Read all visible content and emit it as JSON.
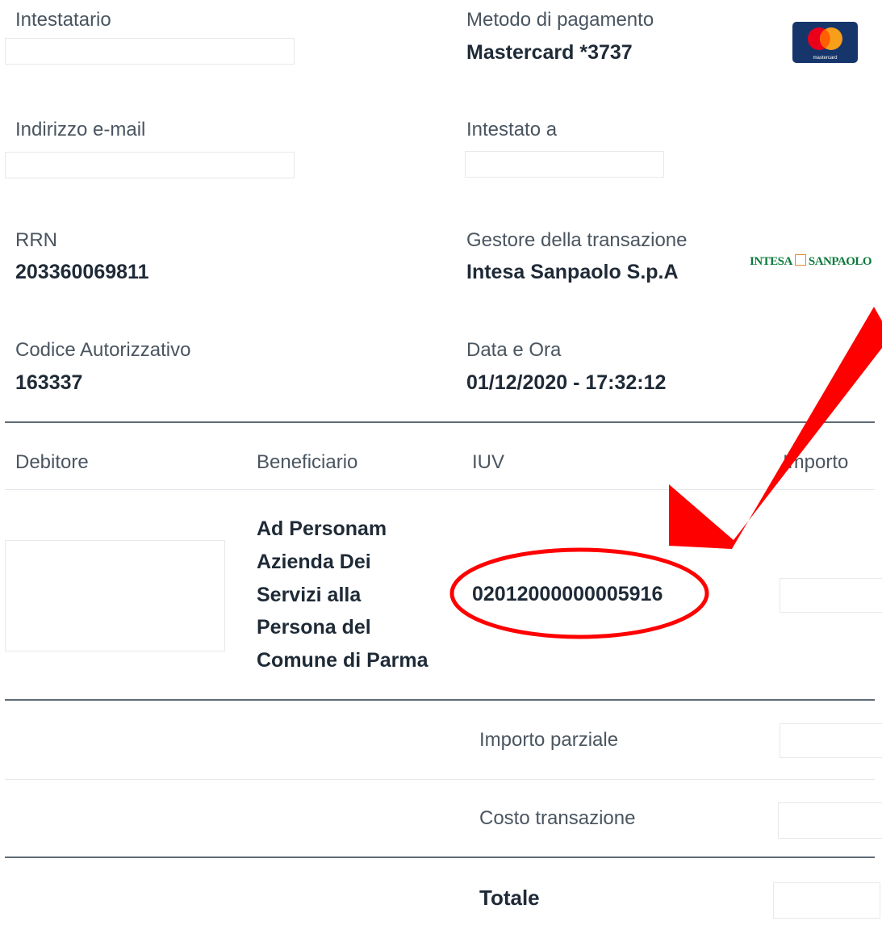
{
  "details": {
    "intestatario_label": "Intestatario",
    "metodo_label": "Metodo di pagamento",
    "metodo_value": "Mastercard *3737",
    "email_label": "Indirizzo e-mail",
    "intestato_label": "Intestato a",
    "rrn_label": "RRN",
    "rrn_value": "203360069811",
    "gestore_label": "Gestore della transazione",
    "gestore_value": "Intesa Sanpaolo S.p.A",
    "codice_label": "Codice Autorizzativo",
    "codice_value": "163337",
    "data_label": "Data e Ora",
    "data_value": "01/12/2020 - 17:32:12"
  },
  "logos": {
    "mastercard_small_text": "mastercard",
    "intesa_left": "INTESA",
    "intesa_right": "SANPAOLO"
  },
  "table": {
    "headers": [
      "Debitore",
      "Beneficiario",
      "IUV",
      "Importo"
    ],
    "row": {
      "beneficiario_lines": [
        "Ad Personam",
        "Azienda Dei",
        "Servizi alla",
        "Persona del",
        "Comune di Parma"
      ],
      "iuv": "02012000000005916"
    }
  },
  "summary": {
    "parziale_label": "Importo parziale",
    "costo_label": "Costo transazione",
    "totale_label": "Totale"
  },
  "colors": {
    "annotation_red": "#ff0000",
    "mastercard_red": "#eb001b",
    "mastercard_orange": "#f79e1b",
    "mastercard_bg": "#16366b",
    "intesa_green": "#0a7a3a"
  }
}
